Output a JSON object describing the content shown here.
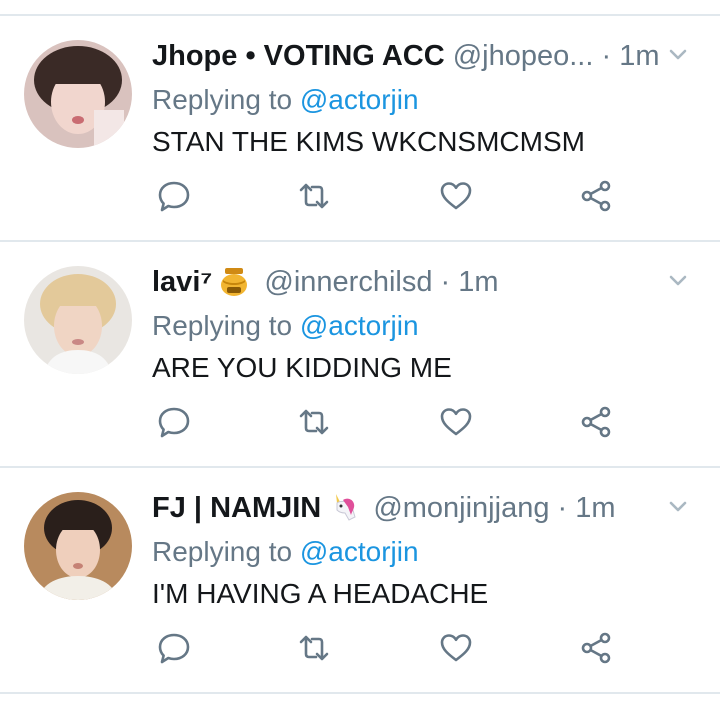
{
  "tweets": [
    {
      "name": "Jhope • VOTING ACC",
      "handle": "@jhopeo...",
      "time": "1m",
      "reply_prefix": "Replying to ",
      "reply_to": "@actorjin",
      "text": "STAN THE KIMS WKCNSMCMSM"
    },
    {
      "name": "lavi⁷",
      "name_emoji": "honey-pot-emoji",
      "handle": "@innerchilsd",
      "time": "1m",
      "reply_prefix": "Replying to ",
      "reply_to": "@actorjin",
      "text": "ARE YOU KIDDING ME"
    },
    {
      "name": "FJ | NAMJIN",
      "name_emoji": "unicorn-emoji",
      "handle": "@monjinjjang",
      "time": "1m",
      "reply_prefix": "Replying to ",
      "reply_to": "@actorjin",
      "text": "I'M HAVING A HEADACHE"
    }
  ],
  "separator": "·",
  "icons": [
    "reply-icon",
    "retweet-icon",
    "like-icon",
    "share-icon",
    "chevron-down-icon"
  ],
  "colors": {
    "text": "#14171a",
    "secondary": "#657786",
    "link": "#1b95e0",
    "divider": "#e1e8ed"
  }
}
